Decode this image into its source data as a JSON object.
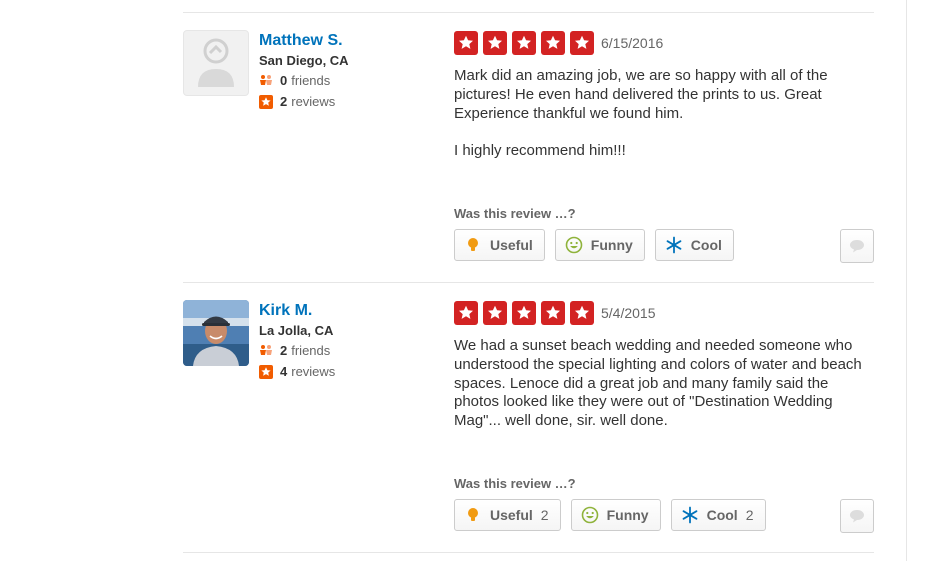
{
  "vote_prompt": "Was this review …?",
  "reviews": [
    {
      "user": {
        "name": "Matthew S.",
        "location": "San Diego, CA",
        "friends_count": "0",
        "friends_label": "friends",
        "reviews_count": "2",
        "reviews_label": "reviews",
        "avatar": "default-user-placeholder"
      },
      "rating": 5,
      "date": "6/15/2016",
      "text": "Mark did an amazing job, we are so happy with all of the pictures! He even hand delivered the prints to us.  Great Experience thankful we found him.\n\nI highly recommend him!!!",
      "votes": {
        "useful_label": "Useful",
        "useful_count": "",
        "funny_label": "Funny",
        "funny_count": "",
        "cool_label": "Cool",
        "cool_count": ""
      }
    },
    {
      "user": {
        "name": "Kirk M.",
        "location": "La Jolla, CA",
        "friends_count": "2",
        "friends_label": "friends",
        "reviews_count": "4",
        "reviews_label": "reviews",
        "avatar": "user-photo"
      },
      "rating": 5,
      "date": "5/4/2015",
      "text": "We had a sunset beach wedding and needed someone who understood the special lighting and colors of water and beach spaces.  Lenoce did a great job and many family said the photos looked like they were out of \"Destination Wedding Mag\"...  well done, sir.  well done.",
      "votes": {
        "useful_label": "Useful",
        "useful_count": "2",
        "funny_label": "Funny",
        "funny_count": "",
        "cool_label": "Cool",
        "cool_count": "2"
      }
    }
  ],
  "colors": {
    "link": "#0073bb",
    "star": "#d32323",
    "useful": "#f19b12",
    "funny": "#8fb33b",
    "cool": "#0073bb"
  }
}
